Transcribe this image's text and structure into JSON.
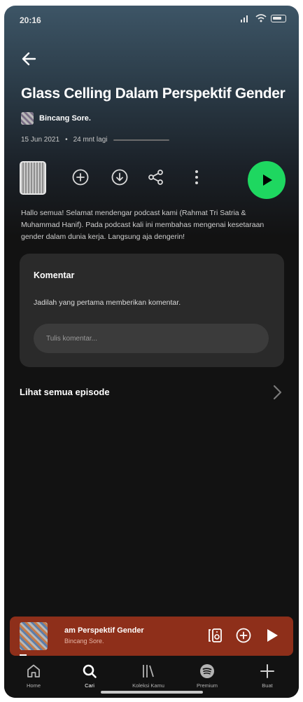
{
  "status_bar": {
    "time": "20:16"
  },
  "episode": {
    "title": "Glass Celling Dalam Perspektif Gender",
    "show_name": "Bincang Sore.",
    "date": "15 Jun 2021",
    "remaining": "24 mnt lagi",
    "description": "Hallo semua! Selamat mendengar podcast kami (Rahmat Tri Satria & Muhammad Hanif). Pada podcast kali ini membahas mengenai kesetaraan gender dalam dunia kerja. Langsung aja dengerin!"
  },
  "icons": {
    "back": "back-arrow-icon",
    "add": "add-circle-icon",
    "download": "download-icon",
    "share": "share-icon",
    "more": "more-vertical-icon",
    "play": "play-icon"
  },
  "comments": {
    "title": "Komentar",
    "empty_text": "Jadilah yang pertama memberikan komentar.",
    "input_placeholder": "Tulis komentar..."
  },
  "all_episodes_label": "Lihat semua episode",
  "mini_player": {
    "title": "am Perspektif Gender",
    "subtitle": "Bincang Sore."
  },
  "nav": [
    {
      "label": "Home",
      "icon": "home-icon"
    },
    {
      "label": "Cari",
      "icon": "search-icon"
    },
    {
      "label": "Koleksi Kamu",
      "icon": "library-icon"
    },
    {
      "label": "Premium",
      "icon": "spotify-icon"
    },
    {
      "label": "Buat",
      "icon": "plus-icon"
    }
  ],
  "colors": {
    "accent": "#1ed760",
    "mini_player_bg": "#8e2f1a",
    "background": "#121212"
  }
}
